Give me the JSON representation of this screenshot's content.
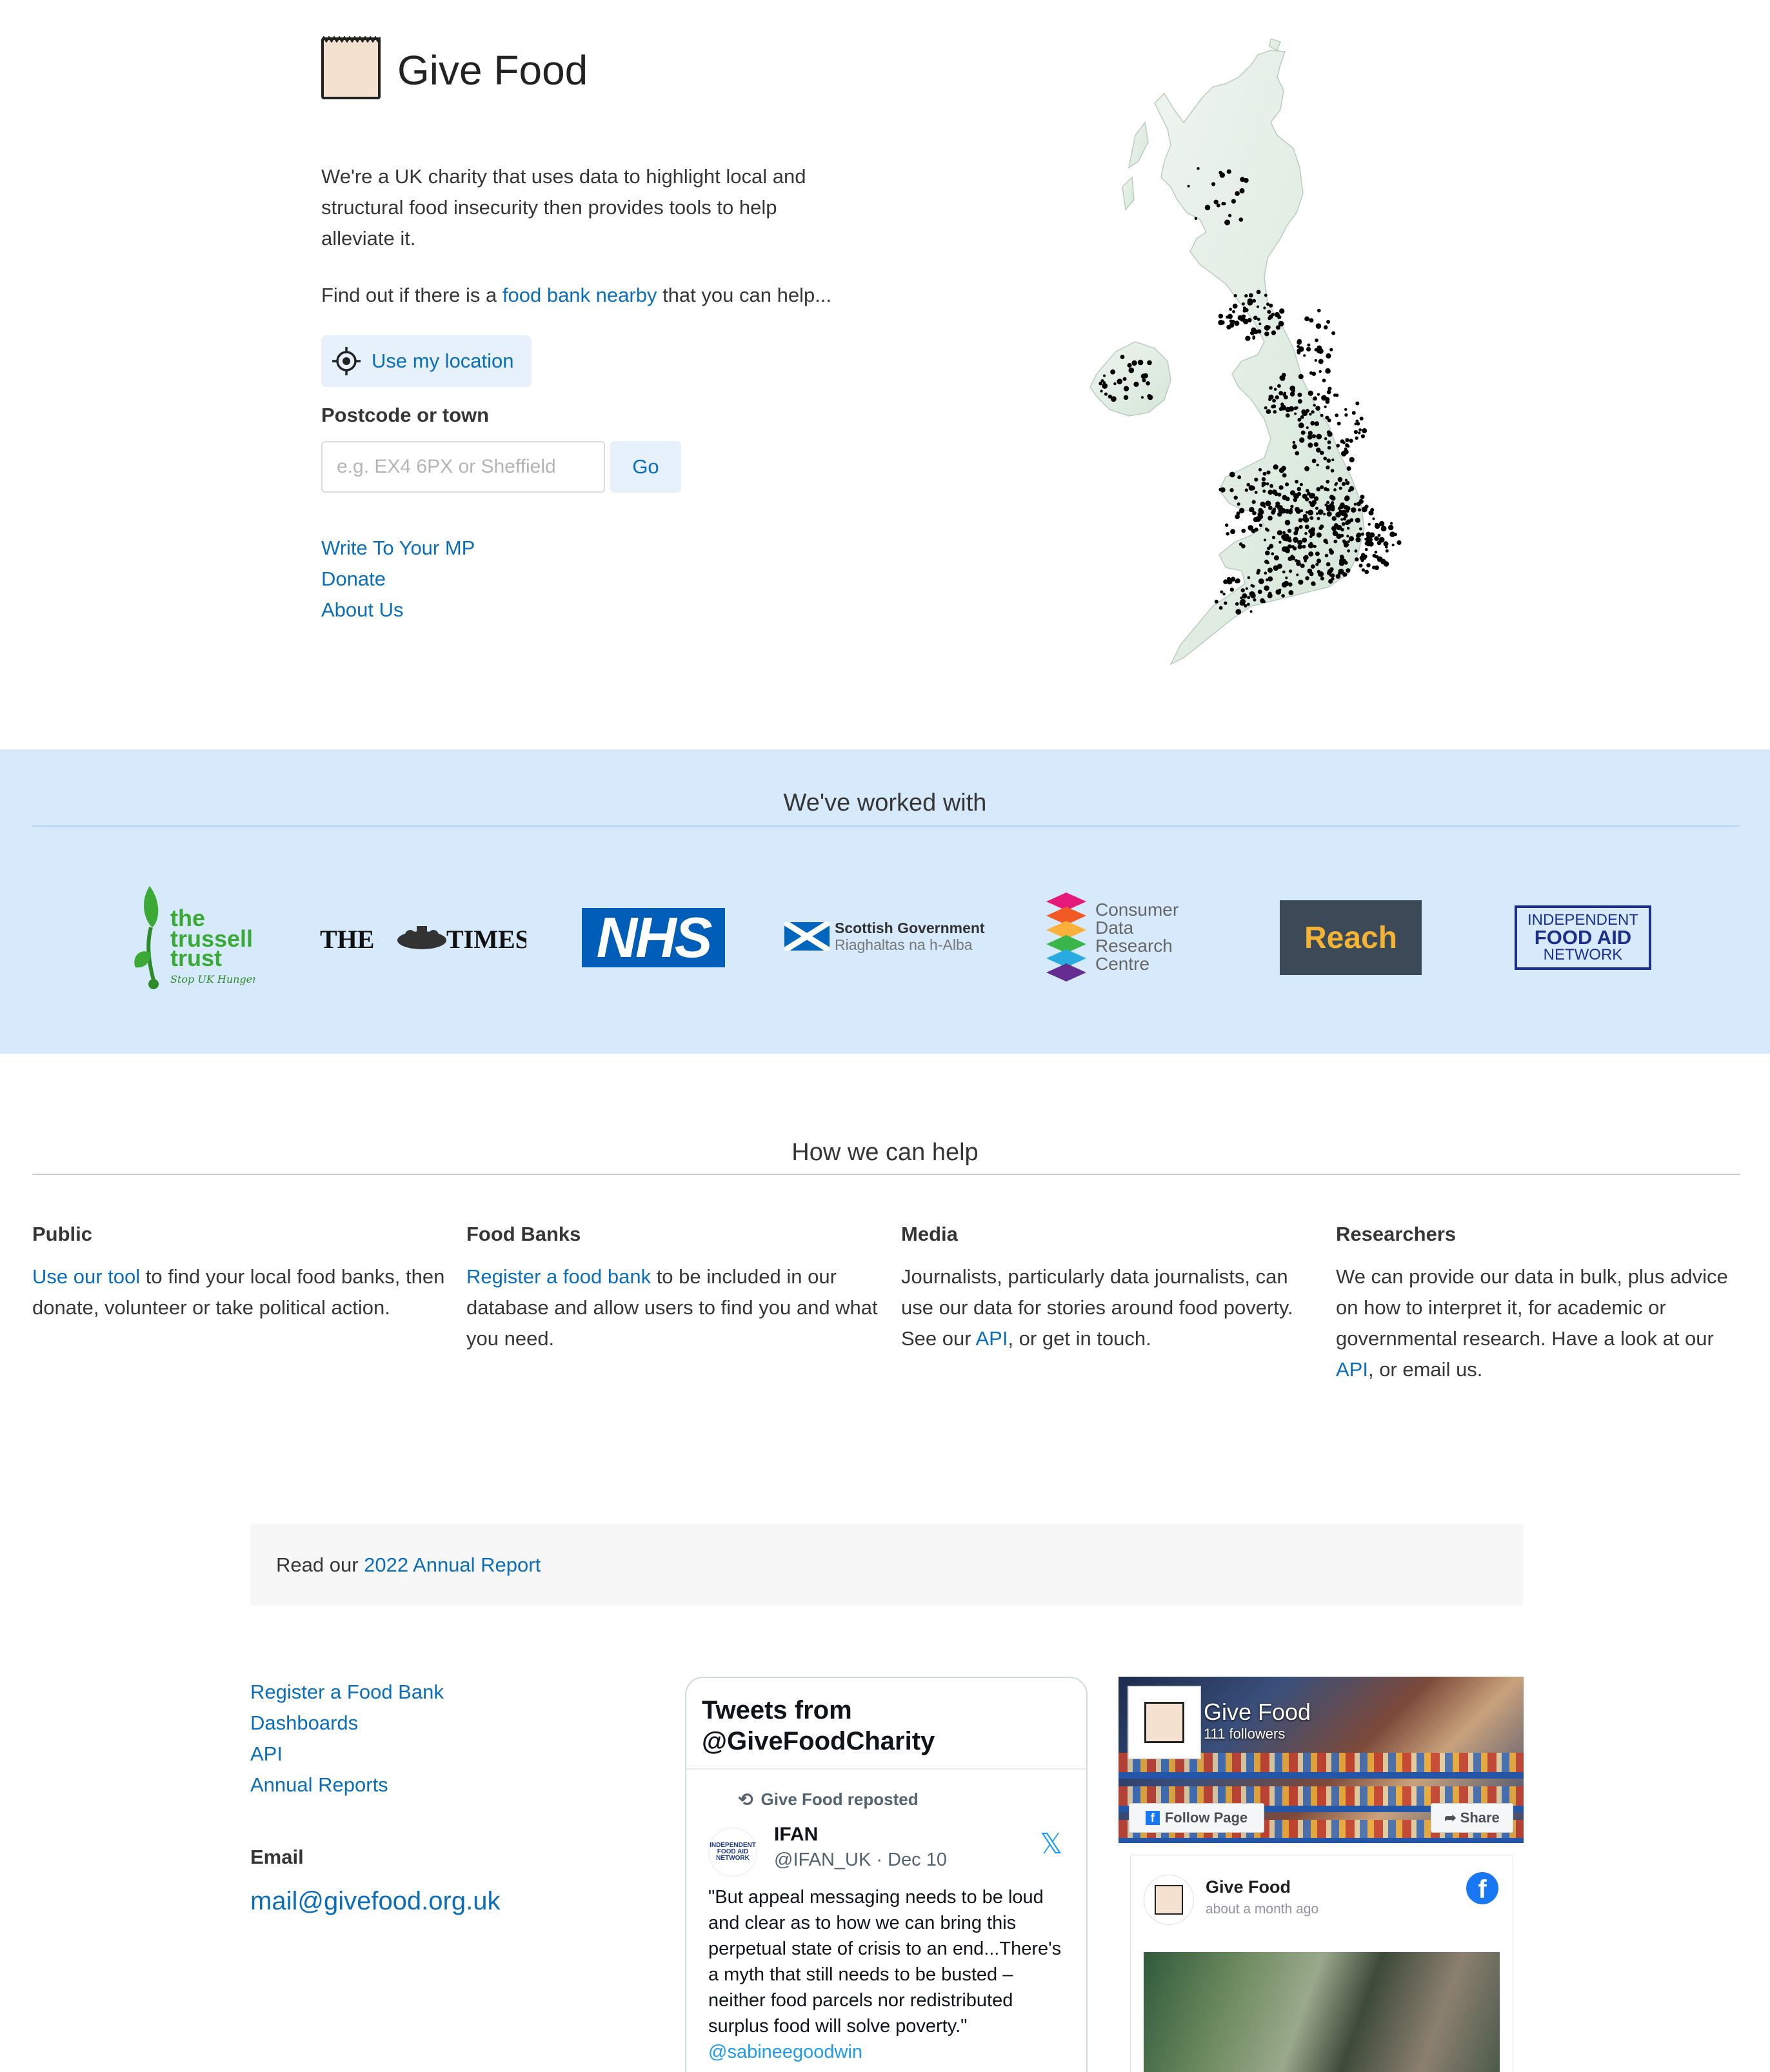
{
  "brand": {
    "title": "Give Food"
  },
  "hero": {
    "intro": "We're a UK charity that uses data to highlight local and structural food insecurity then provides tools to help alleviate it.",
    "nearby_pre": "Find out if there is a ",
    "nearby_link": "food bank nearby",
    "nearby_post": " that you can help...",
    "location_button": "Use my location",
    "postcode_label": "Postcode or town",
    "postcode_placeholder": "e.g. EX4 6PX or Sheffield",
    "postcode_value": "",
    "go_button": "Go",
    "links": [
      "Write To Your MP",
      "Donate",
      "About Us"
    ]
  },
  "partners": {
    "title": "We've worked with",
    "logos": [
      {
        "name": "the trussell trust",
        "tagline": "Stop UK Hunger"
      },
      {
        "name": "THE TIMES"
      },
      {
        "name": "NHS"
      },
      {
        "name": "Scottish Government",
        "subtitle": "Riaghaltas na h-Alba"
      },
      {
        "name": "Consumer Data Research Centre"
      },
      {
        "name": "Reach"
      },
      {
        "name": "INDEPENDENT FOOD AID NETWORK"
      }
    ]
  },
  "help": {
    "title": "How we can help",
    "columns": [
      {
        "heading": "Public",
        "link": "Use our tool",
        "text": " to find your local food banks, then donate, volunteer or take political action."
      },
      {
        "heading": "Food Banks",
        "link": "Register a food bank",
        "text": " to be included in our database and allow users to find you and what you need."
      },
      {
        "heading": "Media",
        "text_pre": "Journalists, particularly data journalists, can use our data for stories around food poverty. See our ",
        "link": "API",
        "text": ", or get in touch."
      },
      {
        "heading": "Researchers",
        "text_pre": "We can provide our data in bulk, plus advice on how to interpret it, for academic or governmental research. Have a look at our ",
        "link": "API",
        "text": ", or email us."
      }
    ]
  },
  "report": {
    "pre": "Read our ",
    "link": "2022 Annual Report"
  },
  "footer": {
    "links": [
      "Register a Food Bank",
      "Dashboards",
      "API",
      "Annual Reports"
    ],
    "email_label": "Email",
    "email": "mail@givefood.org.uk"
  },
  "twitter": {
    "header": "Tweets from @GiveFoodCharity",
    "repost": "Give Food reposted",
    "name": "IFAN",
    "handle": "@IFAN_UK · Dec 10",
    "text": "\"But appeal messaging needs to be loud and clear as to how we can bring this perpetual state of crisis to an end...There's a myth that still needs to be busted – neither food parcels nor redistributed surplus food will solve poverty.\" ",
    "mention": "@sabineegoodwin",
    "avatar_text": "INDEPENDENT FOOD AID NETWORK"
  },
  "facebook": {
    "page_name": "Give Food",
    "followers": "111 followers",
    "follow_button": "Follow Page",
    "share_button": "Share",
    "post_author": "Give Food",
    "post_time": "about a month ago"
  },
  "colors": {
    "link": "#0a6ebd",
    "band": "#d7eafb",
    "nhs": "#005eb8",
    "reach_bg": "#3c4a57",
    "reach_text": "#f5b335",
    "ifan": "#1d2f8c",
    "trussell": "#3aa935"
  }
}
